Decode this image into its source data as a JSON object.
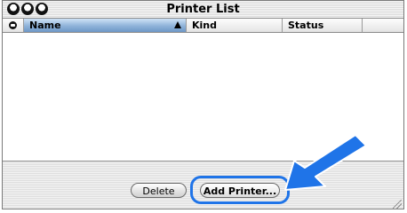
{
  "window": {
    "title": "Printer List"
  },
  "columns": {
    "name": "Name",
    "kind": "Kind",
    "status": "Status"
  },
  "printers": [],
  "buttons": {
    "delete": "Delete",
    "add_printer": "Add Printer..."
  },
  "colors": {
    "highlight": "#1f74e8",
    "arrow": "#1f74e8",
    "sort_column": "#8fb3d9"
  },
  "icons": {
    "sort": "sort-ascending-arrow-icon",
    "status_column": "phone-icon"
  }
}
